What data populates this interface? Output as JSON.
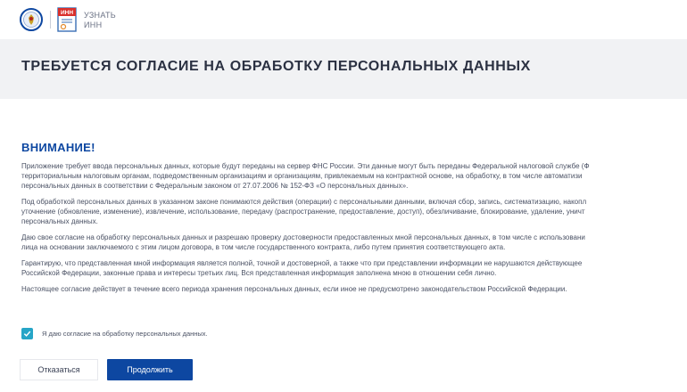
{
  "header": {
    "brand_line1": "УЗНАТЬ",
    "brand_line2": "ИНН",
    "logo_text": "ИНН",
    "emblem_icon": "fns-emblem-icon",
    "logo_icon": "inn-document-icon"
  },
  "page": {
    "title": "ТРЕБУЕТСЯ СОГЛАСИЕ НА ОБРАБОТКУ ПЕРСОНАЛЬНЫХ ДАННЫХ"
  },
  "notice": {
    "heading": "ВНИМАНИЕ!",
    "paragraphs": [
      {
        "lines": [
          "Приложение требует ввода персональных данных, которые будут переданы на сервер ФНС России. Эти данные могут быть переданы Федеральной налоговой службе (Ф",
          "территориальным налоговым органам, подведомственным организациям и организациям, привлекаемым на контрактной основе, на обработку, в том числе автоматизи",
          "персональных данных в соответствии с Федеральным законом от 27.07.2006 № 152-ФЗ «О персональных данных»."
        ]
      },
      {
        "lines": [
          "Под обработкой персональных данных в указанном законе понимаются действия (операции) с персональными данными, включая сбор, запись, систематизацию, накопл",
          "уточнение (обновление, изменение), извлечение, использование, передачу (распространение, предоставление, доступ), обезличивание, блокирование, удаление, уничт",
          "персональных данных."
        ]
      },
      {
        "lines": [
          "Даю свое согласие на обработку персональных данных и разрешаю проверку достоверности предоставленных мной персональных данных, в том числе с использовани",
          "лица на основании заключаемого с этим лицом договора, в том числе государственного контракта, либо путем принятия соответствующего акта."
        ]
      },
      {
        "lines": [
          "Гарантирую, что представленная мной информация является полной, точной и достоверной, а также что при представлении информации не нарушаются действующее",
          "Российской Федерации, законные права и интересы третьих лиц. Вся представленная информация заполнена мною в отношении себя лично."
        ]
      },
      {
        "lines": [
          "Настоящее согласие действует в течение всего периода хранения персональных данных, если иное не предусмотрено законодательством Российской Федерации."
        ]
      }
    ]
  },
  "consent": {
    "checked": true,
    "label": "Я даю согласие на обработку персональных данных.",
    "check_icon": "checkmark-icon"
  },
  "actions": {
    "decline_label": "Отказаться",
    "continue_label": "Продолжить"
  },
  "colors": {
    "accent": "#0d47a1",
    "checkbox": "#26a5c7",
    "title_band": "#f1f2f4"
  }
}
